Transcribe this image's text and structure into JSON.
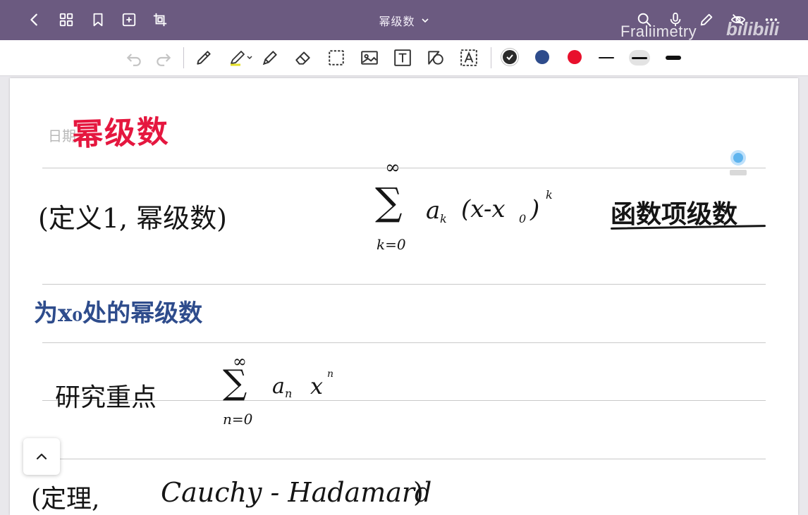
{
  "header": {
    "title": "幂级数",
    "watermark": "Fraliimetry",
    "bili_logo": "bilibili"
  },
  "toolbar": {
    "colors": {
      "black": "#2b2b2b",
      "blue": "#2e4c8c",
      "red": "#e8102c"
    }
  },
  "note": {
    "date_label": "日期",
    "heading": "幂级数",
    "definition": "(定义1, 幂级数)",
    "series_upper": "∞",
    "series_lower": "k=0",
    "series_term": "a",
    "series_sub": "k",
    "series_paren": "(x-x",
    "series_paren_sub": "0",
    "series_paren_close": ")",
    "series_exp": "k",
    "right_label": "函数项级数",
    "blue_line": "为x₀处的幂级数",
    "focus_label": "研究重点",
    "sum2_upper": "∞",
    "sum2_lower": "n=0",
    "sum2_coef": "a",
    "sum2_coef_sub": "n",
    "sum2_var": "x",
    "sum2_exp": "n",
    "theorem_open": "(定理,",
    "theorem_name": "Cauchy - Hadamard",
    "theorem_close": ")"
  }
}
